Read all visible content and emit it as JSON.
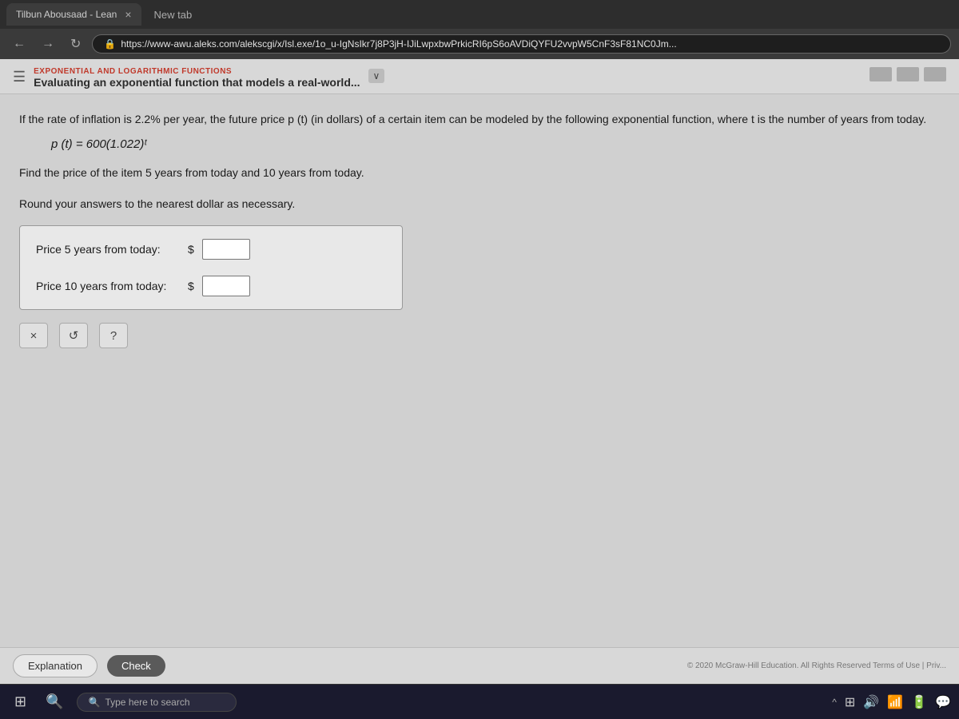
{
  "browser": {
    "tab_title": "Tilbun Abousaad - Lean",
    "tab_close": "×",
    "new_tab_label": "New tab",
    "address": "https://www-awu.aleks.com/alekscgi/x/Isl.exe/1o_u-IgNsIkr7j8P3jH-IJiLwpxbwPrkicRI6pS6oAVDiQYFU2vvpW5CnF3sF81NC0Jm...",
    "lock_icon": "🔒"
  },
  "header": {
    "topic_label": "EXPONENTIAL AND LOGARITHMIC FUNCTIONS",
    "topic_title": "Evaluating an exponential function that models a real-world...",
    "chevron_label": "∨"
  },
  "problem": {
    "intro": "If the rate of inflation is 2.2% per year, the future price p (t) (in dollars) of a certain item can be modeled by the following exponential function, where t is the number of years from today.",
    "formula": "p (t) = 600(1.022)ᵗ",
    "instruction_line1": "Find the price of the item 5 years from today and 10 years from today.",
    "instruction_line2": "Round your answers to the nearest dollar as necessary.",
    "field1_label": "Price 5 years from today:",
    "field1_dollar": "$",
    "field1_value": "",
    "field2_label": "Price 10 years from today:",
    "field2_dollar": "$",
    "field2_value": "",
    "btn_x": "×",
    "btn_undo": "↺",
    "btn_help": "?"
  },
  "bottom_bar": {
    "explanation_label": "Explanation",
    "check_label": "Check",
    "copyright": "© 2020 McGraw-Hill Education. All Rights Reserved   Terms of Use  |  Priv..."
  },
  "taskbar": {
    "search_placeholder": "Type here to search",
    "search_icon": "🔍"
  }
}
